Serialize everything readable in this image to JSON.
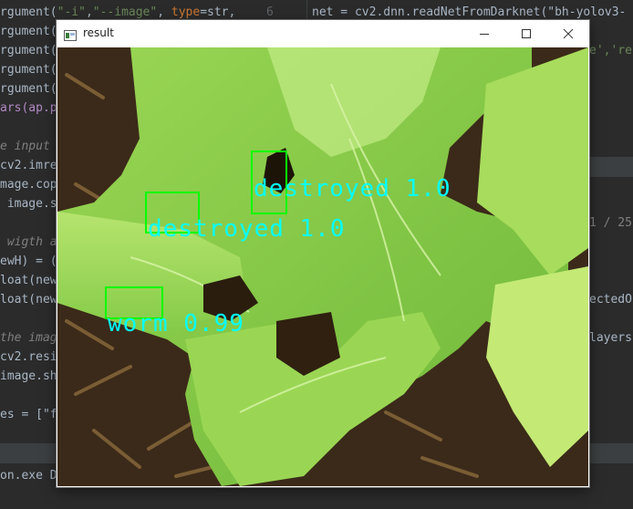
{
  "ide": {
    "left_lines": [
      {
        "pre": "rgument(",
        "s": "\"-i\"",
        "m": ",",
        "s2": "\"--image\"",
        "m2": ", ",
        "kw": "type",
        "rest": "=str, "
      },
      {
        "text": "rgument("
      },
      {
        "text": "rgument("
      },
      {
        "text": "rgument("
      },
      {
        "text": "rgument("
      },
      {
        "text": "ars(ap.p"
      },
      {
        "text": ""
      },
      {
        "text": "e input"
      },
      {
        "text": "cv2.imre"
      },
      {
        "text": "mage.cop"
      },
      {
        "text": " image.s"
      },
      {
        "text": ""
      },
      {
        "text": " wigth a"
      },
      {
        "text": "ewH) = ("
      },
      {
        "text": "loat(new"
      },
      {
        "text": "loat(new"
      },
      {
        "text": ""
      },
      {
        "text": "the imag"
      },
      {
        "text": "cv2.resi"
      },
      {
        "text": "image.sh"
      },
      {
        "text": ""
      },
      {
        "text": "es = [\"f"
      }
    ],
    "line_number": "6",
    "right_line": "net = cv2.dnn.readNetFromDarknet(\"bh-yolov3-",
    "right_fragments": {
      "frag1": "e','re",
      "frag2": "1 / 25",
      "frag3": "ectedO",
      "frag4": "layers"
    },
    "console_text": "on.exe D"
  },
  "window": {
    "title": "result",
    "controls": {
      "minimize_icon": "minimize-icon",
      "maximize_icon": "maximize-icon",
      "close_icon": "close-icon"
    }
  },
  "detections": [
    {
      "label": "destroyed 1.0"
    },
    {
      "label": "destroyed 1.0"
    },
    {
      "label": "worm 0.99"
    }
  ],
  "colors": {
    "box": "#00ff00",
    "label": "#00ffff",
    "leaf": "#8fd14f",
    "soil": "#3a2a1a"
  }
}
